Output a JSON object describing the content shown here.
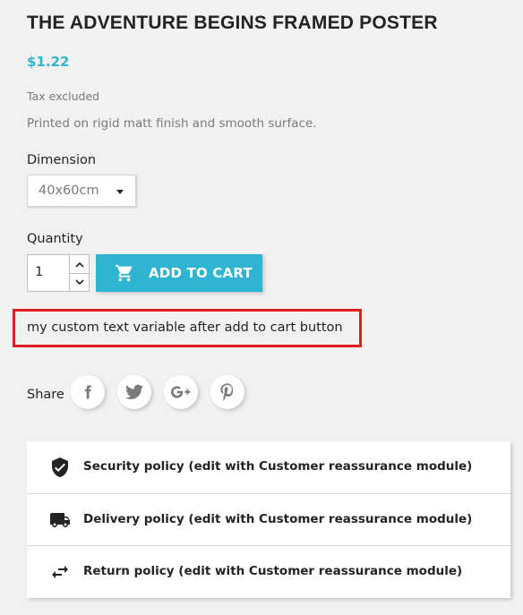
{
  "product": {
    "title": "THE ADVENTURE BEGINS FRAMED POSTER",
    "price": "$1.22",
    "tax_note": "Tax excluded",
    "description": "Printed on rigid matt finish and smooth surface."
  },
  "variant": {
    "label": "Dimension",
    "selected": "40x60cm"
  },
  "quantity": {
    "label": "Quantity",
    "value": "1"
  },
  "add_to_cart": {
    "label": "ADD TO CART",
    "icon": "shopping-cart-icon"
  },
  "custom_text": "my custom text variable after add to cart button",
  "share": {
    "label": "Share",
    "networks": [
      "facebook",
      "twitter",
      "google-plus",
      "pinterest"
    ]
  },
  "reassurance": [
    {
      "icon": "shield-check-icon",
      "text": "Security policy (edit with Customer reassurance module)"
    },
    {
      "icon": "truck-icon",
      "text": "Delivery policy (edit with Customer reassurance module)"
    },
    {
      "icon": "swap-arrows-icon",
      "text": "Return policy (edit with Customer reassurance module)"
    }
  ],
  "colors": {
    "accent": "#2fb5d2",
    "highlight_border": "#e02020",
    "background": "#f1f1f1"
  }
}
